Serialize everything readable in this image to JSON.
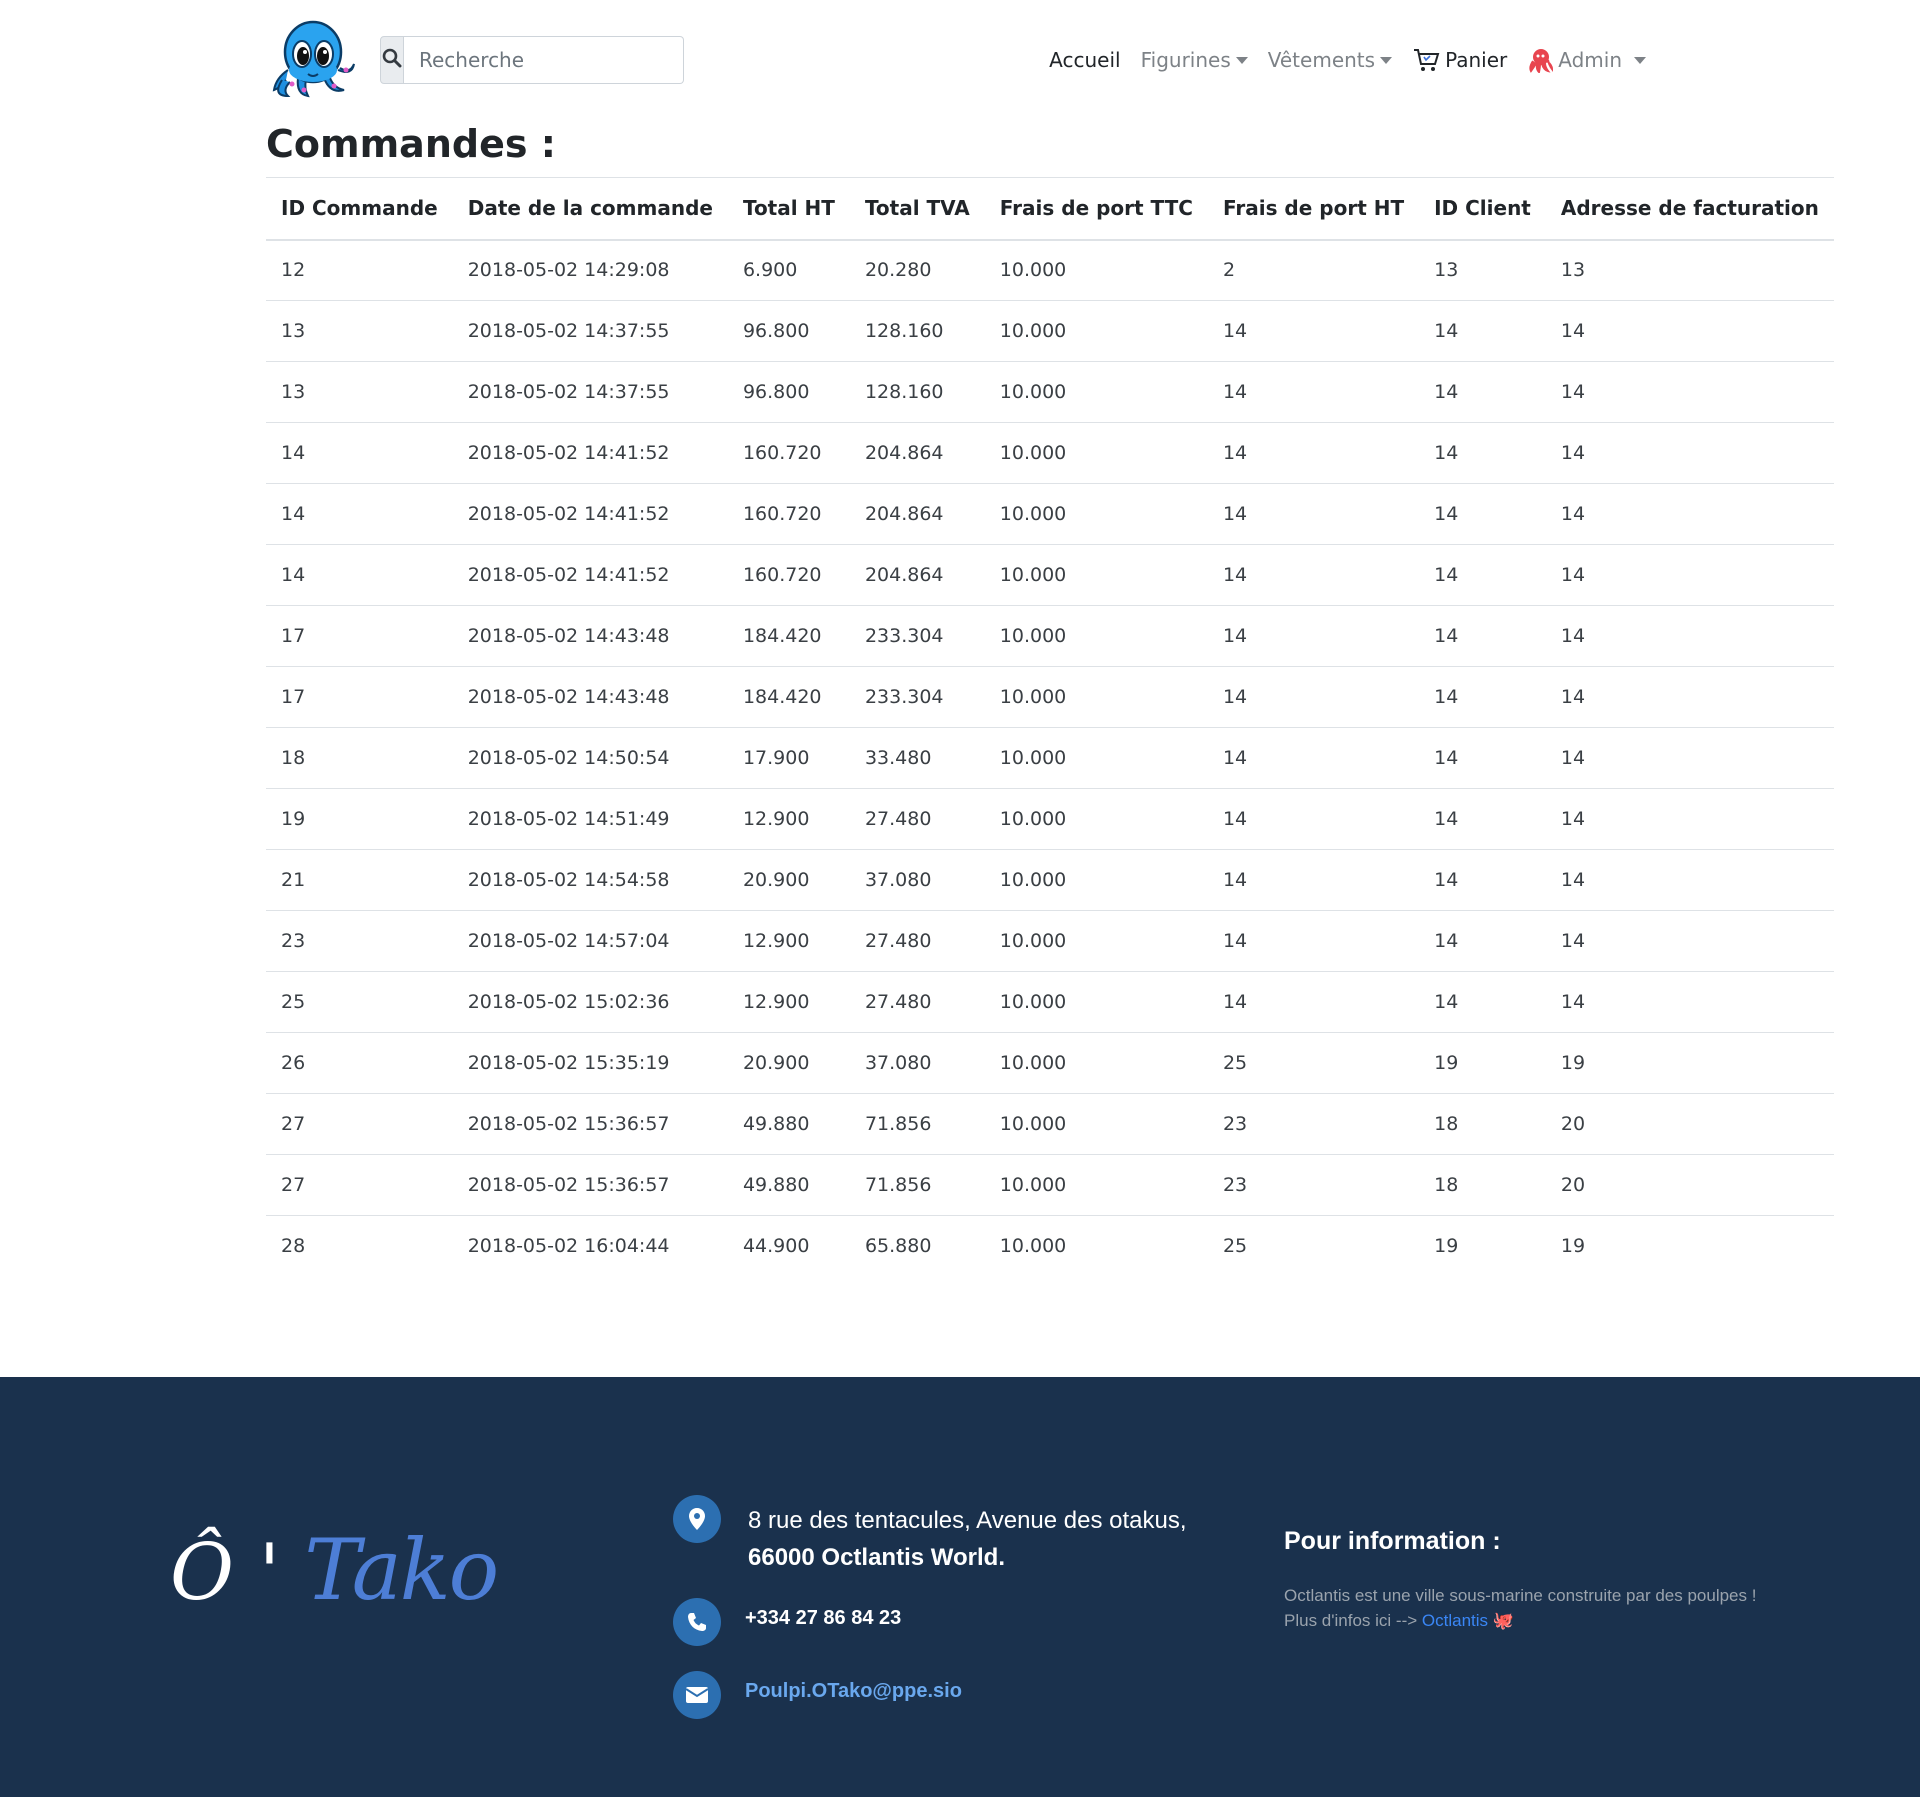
{
  "navbar": {
    "search_placeholder": "Recherche",
    "items": [
      {
        "label": "Accueil"
      },
      {
        "label": "Figurines"
      },
      {
        "label": "Vêtements"
      },
      {
        "label": "Panier"
      },
      {
        "label": "Admin"
      }
    ]
  },
  "page": {
    "title": "Commandes :"
  },
  "table": {
    "headers": [
      "ID Commande",
      "Date de la commande",
      "Total HT",
      "Total TVA",
      "Frais de port TTC",
      "Frais de port HT",
      "ID Client",
      "Adresse de facturation"
    ],
    "rows": [
      [
        "12",
        "2018-05-02 14:29:08",
        "6.900",
        "20.280",
        "10.000",
        "2",
        "13",
        "13"
      ],
      [
        "13",
        "2018-05-02 14:37:55",
        "96.800",
        "128.160",
        "10.000",
        "14",
        "14",
        "14"
      ],
      [
        "13",
        "2018-05-02 14:37:55",
        "96.800",
        "128.160",
        "10.000",
        "14",
        "14",
        "14"
      ],
      [
        "14",
        "2018-05-02 14:41:52",
        "160.720",
        "204.864",
        "10.000",
        "14",
        "14",
        "14"
      ],
      [
        "14",
        "2018-05-02 14:41:52",
        "160.720",
        "204.864",
        "10.000",
        "14",
        "14",
        "14"
      ],
      [
        "14",
        "2018-05-02 14:41:52",
        "160.720",
        "204.864",
        "10.000",
        "14",
        "14",
        "14"
      ],
      [
        "17",
        "2018-05-02 14:43:48",
        "184.420",
        "233.304",
        "10.000",
        "14",
        "14",
        "14"
      ],
      [
        "17",
        "2018-05-02 14:43:48",
        "184.420",
        "233.304",
        "10.000",
        "14",
        "14",
        "14"
      ],
      [
        "18",
        "2018-05-02 14:50:54",
        "17.900",
        "33.480",
        "10.000",
        "14",
        "14",
        "14"
      ],
      [
        "19",
        "2018-05-02 14:51:49",
        "12.900",
        "27.480",
        "10.000",
        "14",
        "14",
        "14"
      ],
      [
        "21",
        "2018-05-02 14:54:58",
        "20.900",
        "37.080",
        "10.000",
        "14",
        "14",
        "14"
      ],
      [
        "23",
        "2018-05-02 14:57:04",
        "12.900",
        "27.480",
        "10.000",
        "14",
        "14",
        "14"
      ],
      [
        "25",
        "2018-05-02 15:02:36",
        "12.900",
        "27.480",
        "10.000",
        "14",
        "14",
        "14"
      ],
      [
        "26",
        "2018-05-02 15:35:19",
        "20.900",
        "37.080",
        "10.000",
        "25",
        "19",
        "19"
      ],
      [
        "27",
        "2018-05-02 15:36:57",
        "49.880",
        "71.856",
        "10.000",
        "23",
        "18",
        "20"
      ],
      [
        "27",
        "2018-05-02 15:36:57",
        "49.880",
        "71.856",
        "10.000",
        "23",
        "18",
        "20"
      ],
      [
        "28",
        "2018-05-02 16:04:44",
        "44.900",
        "65.880",
        "10.000",
        "25",
        "19",
        "19"
      ]
    ]
  },
  "footer": {
    "brand_o": "Ô '",
    "brand_tako": "Tako",
    "address_line1": "8 rue des tentacules, Avenue des otakus,",
    "address_line2": "66000 Octlantis World.",
    "phone": "+334 27 86 84 23",
    "email": "Poulpi.OTako@ppe.sio",
    "info_title": "Pour information :",
    "info_line1": "Octlantis est une ville sous-marine construite par des poulpes !",
    "info_line2_prefix": "Plus d'infos ici -->",
    "info_link": "Octlantis",
    "info_emoji": "🐙"
  },
  "colors": {
    "footer_bg": "#1a314d",
    "accent_blue": "#2c6fb1",
    "link_blue": "#3a86f5",
    "brand_blue": "#4d7ed6"
  },
  "icons": [
    "search-icon",
    "cart-icon",
    "octopus-icon",
    "location-pin-icon",
    "phone-icon",
    "envelope-icon",
    "octopus-logo"
  ]
}
